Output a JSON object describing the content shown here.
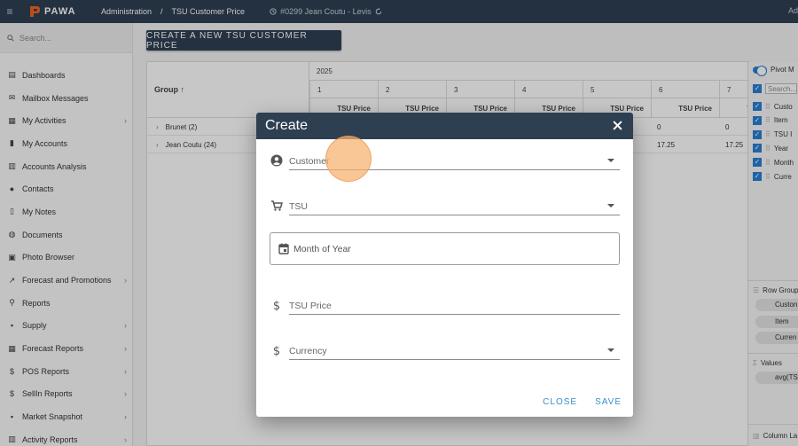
{
  "topbar": {
    "brand": "PAWA",
    "breadcrumb": [
      "Administration",
      "TSU Customer Price"
    ],
    "customer": "#0299 Jean Coutu - Levis",
    "right_text": "Ad"
  },
  "sidebar": {
    "search_placeholder": "Search...",
    "items": [
      {
        "label": "Dashboards",
        "icon": "dashboard-icon",
        "chevron": false
      },
      {
        "label": "Mailbox Messages",
        "icon": "mailbox-icon",
        "chevron": false
      },
      {
        "label": "My Activities",
        "icon": "calendar-icon",
        "chevron": true
      },
      {
        "label": "My Accounts",
        "icon": "accounts-icon",
        "chevron": false
      },
      {
        "label": "Accounts Analysis",
        "icon": "analysis-icon",
        "chevron": false
      },
      {
        "label": "Contacts",
        "icon": "contacts-icon",
        "chevron": false
      },
      {
        "label": "My Notes",
        "icon": "notes-icon",
        "chevron": false
      },
      {
        "label": "Documents",
        "icon": "documents-icon",
        "chevron": false
      },
      {
        "label": "Photo Browser",
        "icon": "photo-icon",
        "chevron": false
      },
      {
        "label": "Forecast and Promotions",
        "icon": "trend-icon",
        "chevron": true
      },
      {
        "label": "Reports",
        "icon": "search-icon",
        "chevron": false
      },
      {
        "label": "Supply",
        "icon": "supply-icon",
        "chevron": true
      },
      {
        "label": "Forecast Reports",
        "icon": "table-icon",
        "chevron": true
      },
      {
        "label": "POS Reports",
        "icon": "dollar-icon",
        "chevron": true
      },
      {
        "label": "SellIn Reports",
        "icon": "dollar-icon",
        "chevron": true
      },
      {
        "label": "Market Snapshot",
        "icon": "cart-icon",
        "chevron": true
      },
      {
        "label": "Activity Reports",
        "icon": "activity-icon",
        "chevron": true
      }
    ]
  },
  "main": {
    "create_button": "CREATE A NEW TSU CUSTOMER PRICE",
    "group_header": "Group ↑",
    "year": "2025",
    "months": [
      "1",
      "2",
      "3",
      "4",
      "5",
      "6",
      "7"
    ],
    "price_label": "TSU Price",
    "rows": [
      {
        "name": "Brunet (2)",
        "col6": "0",
        "col7": "0"
      },
      {
        "name": "Jean Coutu (24)",
        "col6": "17.25",
        "col7": "17.25"
      }
    ]
  },
  "rpanel": {
    "pivot_label": "Pivot M",
    "search_placeholder": "Search...",
    "columns": [
      "Custo",
      "Item",
      "TSU I",
      "Year",
      "Month",
      "Curre"
    ],
    "row_groups_label": "Row Group",
    "row_groups": [
      "Custon",
      "Item",
      "Curren"
    ],
    "values_label": "Values",
    "values": [
      "avg(TS"
    ],
    "column_labels": "Column La"
  },
  "dialog": {
    "title": "Create",
    "fields": {
      "customer": "Customer",
      "tsu": "TSU",
      "month": "Month of Year",
      "price": "TSU Price",
      "currency": "Currency"
    },
    "close_label": "CLOSE",
    "save_label": "SAVE"
  },
  "colors": {
    "header_bg": "#2f3f52",
    "accent_blue": "#2a7fd4",
    "action_blue": "#3b8fc8",
    "touch_indicator": "#f6b06e",
    "brand_orange": "#f26522"
  }
}
